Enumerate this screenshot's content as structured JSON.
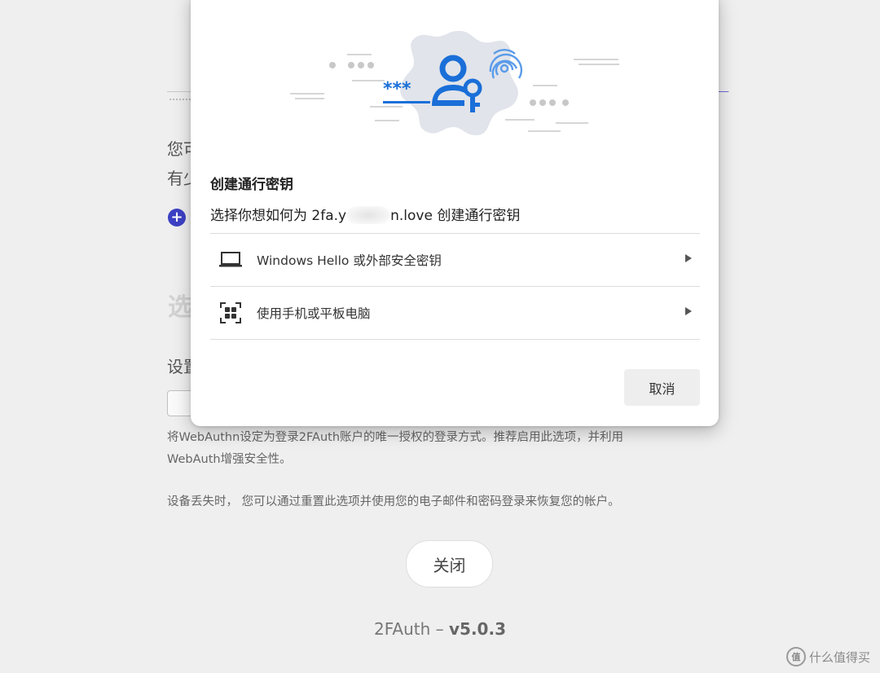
{
  "background": {
    "line1": "您可",
    "line2": "有少",
    "heading": "选",
    "label": "设置",
    "help_line1": "将WebAuthn设定为登录2FAuth账户的唯一授权的登录方式。推荐启用此选项，并利用",
    "help_line2": "WebAuth增强安全性。",
    "help_line3": "设备丢失时， 您可以通过重置此选项并使用您的电子邮件和密码登录来恢复您的帐户。",
    "close_label": "关闭",
    "footer_app": "2FAuth – ",
    "footer_version": "v5.0.3",
    "accent_color": "#3c41c4"
  },
  "dialog": {
    "title": "创建通行密钥",
    "subtitle_prefix": "选择你想如何为 2fa.y",
    "subtitle_suffix": "n.love 创建通行密钥",
    "options": [
      {
        "label": "Windows Hello 或外部安全密钥",
        "icon": "laptop-icon"
      },
      {
        "label": "使用手机或平板电脑",
        "icon": "qr-phone-icon"
      }
    ],
    "cancel_label": "取消",
    "illustration_color": "#1a6fd8"
  },
  "watermark": {
    "badge": "值",
    "text": "什么值得买"
  }
}
